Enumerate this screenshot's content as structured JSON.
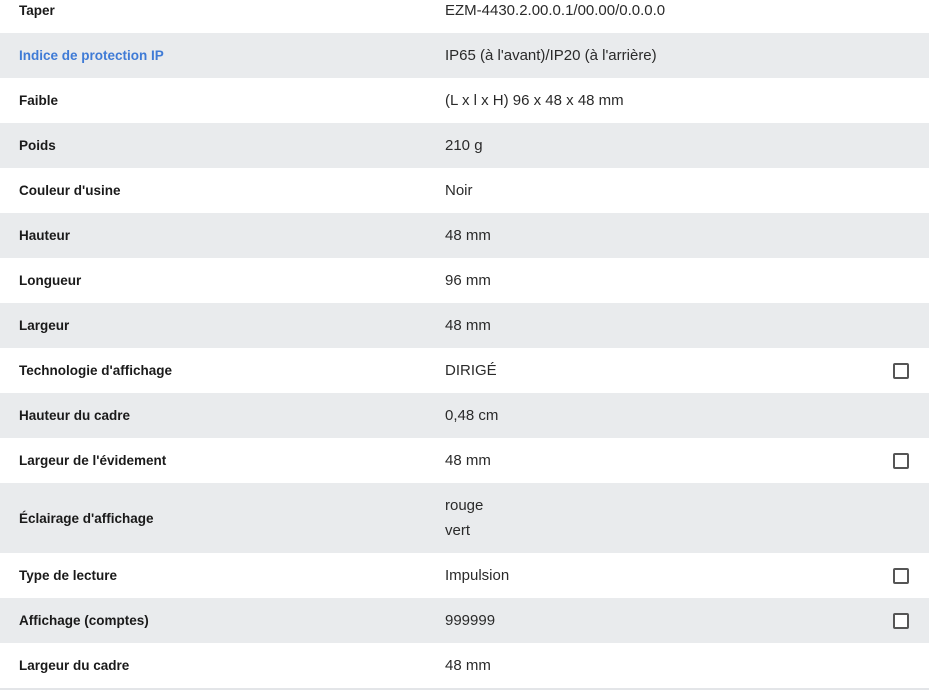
{
  "specs": {
    "rows": [
      {
        "label": "Taper",
        "value": "EZM-4430.2.00.0.1/00.00/0.0.0.0"
      },
      {
        "label": "Indice de protection IP",
        "value": "IP65 (à l'avant)/IP20 (à l'arrière)"
      },
      {
        "label": "Faible",
        "value": "(L x l x H) 96 x 48 x 48 mm"
      },
      {
        "label": "Poids",
        "value": "210 g"
      },
      {
        "label": "Couleur d'usine",
        "value": "Noir"
      },
      {
        "label": "Hauteur",
        "value": "48 mm"
      },
      {
        "label": "Longueur",
        "value": "96 mm"
      },
      {
        "label": "Largeur",
        "value": "48 mm"
      },
      {
        "label": "Technologie d'affichage",
        "value": "DIRIGÉ"
      },
      {
        "label": "Hauteur du cadre",
        "value": "0,48 cm"
      },
      {
        "label": "Largeur de l'évidement",
        "value": "48 mm"
      },
      {
        "label": "Éclairage d'affichage",
        "value_lines": [
          "rouge",
          "vert"
        ]
      },
      {
        "label": "Type de lecture",
        "value": "Impulsion"
      },
      {
        "label": "Affichage (comptes)",
        "value": "999999"
      },
      {
        "label": "Largeur du cadre",
        "value": "48 mm"
      }
    ]
  }
}
